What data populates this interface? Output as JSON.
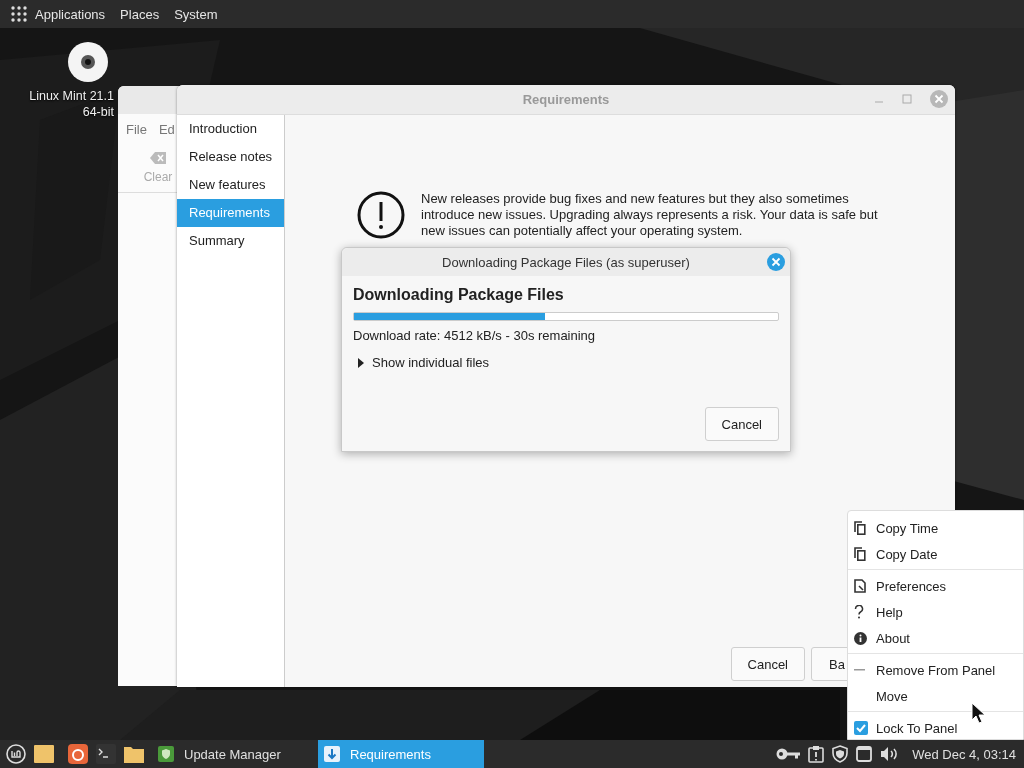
{
  "top_panel": {
    "menus": [
      "Applications",
      "Places",
      "System"
    ]
  },
  "desktop_icons": [
    {
      "label": "Linux Mint 21.1 64-bit"
    }
  ],
  "back_window": {
    "menus": [
      "File",
      "Ed"
    ],
    "toolbar": [
      "Clear"
    ]
  },
  "window": {
    "title": "Requirements",
    "focused": false,
    "sidebar": {
      "items": [
        {
          "label": "Introduction",
          "selected": false
        },
        {
          "label": "Release notes",
          "selected": false
        },
        {
          "label": "New features",
          "selected": false
        },
        {
          "label": "Requirements",
          "selected": true
        },
        {
          "label": "Summary",
          "selected": false
        }
      ]
    },
    "warning": "New releases provide bug fixes and new features but they also sometimes introduce new issues. Upgrading always represents a risk. Your data is safe but new issues can potentially affect your operating system.",
    "buttons": [
      "Cancel",
      "Ba"
    ]
  },
  "dialog": {
    "title": "Downloading Package Files (as superuser)",
    "heading": "Downloading Package Files",
    "progress": {
      "level": 0.45
    },
    "status": "Download rate: 4512 kB/s - 30s remaining",
    "expander": {
      "label": "Show individual files",
      "expanded": false
    },
    "button": "Cancel"
  },
  "context_menu": {
    "sections": [
      [
        {
          "label": "Copy Time",
          "kind": "copy"
        },
        {
          "label": "Copy Date",
          "kind": "copy"
        }
      ],
      [
        {
          "label": "Preferences",
          "kind": "preferences"
        },
        {
          "label": "Help",
          "kind": "help"
        },
        {
          "label": "About",
          "kind": "about"
        }
      ],
      [
        {
          "label": "Remove From Panel",
          "kind": "remove"
        },
        {
          "label": "Move",
          "kind": "plain"
        }
      ],
      [
        {
          "label": "Lock To Panel",
          "kind": "check",
          "checked": true
        }
      ]
    ]
  },
  "taskbar": {
    "windows": [
      {
        "label": "Update Manager",
        "selected": false
      },
      {
        "label": "Requirements",
        "selected": true
      }
    ],
    "clock": "Wed Dec 4, 03:14"
  }
}
